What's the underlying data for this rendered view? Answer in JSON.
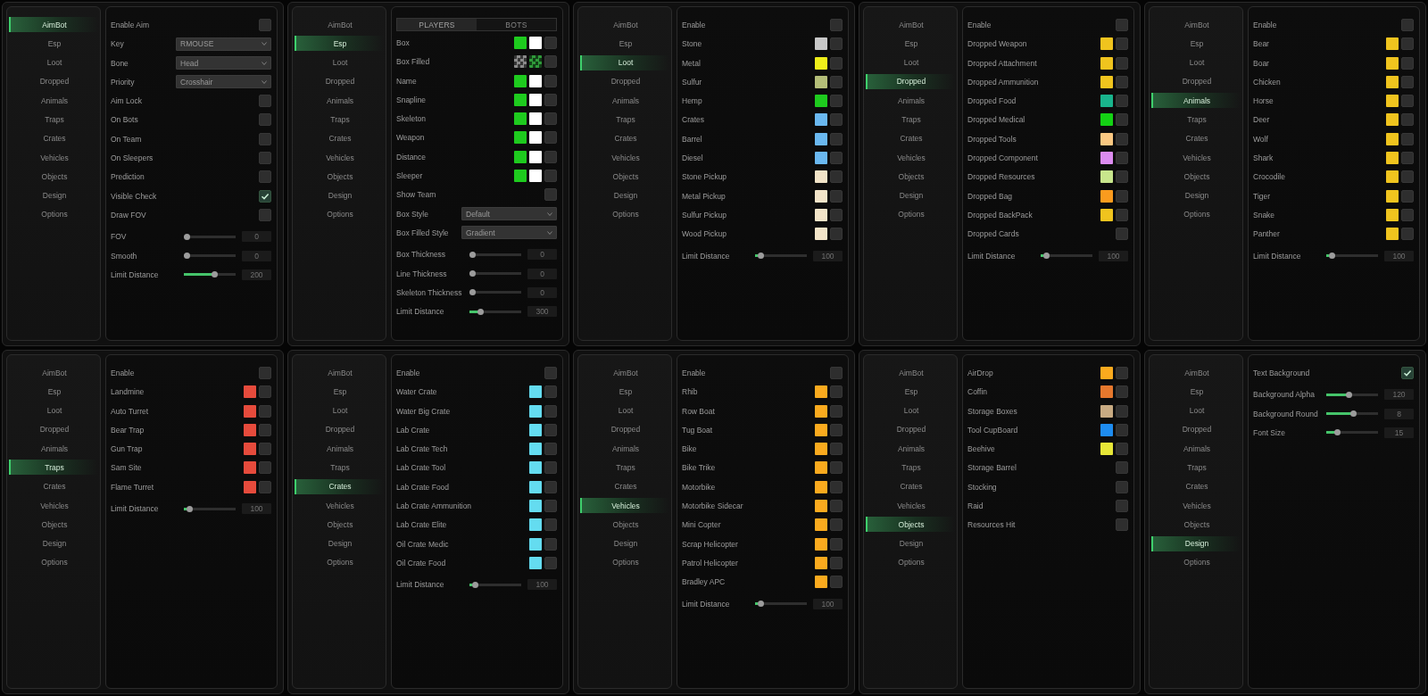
{
  "panels": [
    {
      "sidebar": [
        {
          "label": "AimBot",
          "selected": true
        },
        {
          "label": "Esp",
          "selected": false
        },
        {
          "label": "Loot",
          "selected": false
        },
        {
          "label": "Dropped",
          "selected": false
        },
        {
          "label": "Animals",
          "selected": false
        },
        {
          "label": "Traps",
          "selected": false
        },
        {
          "label": "Crates",
          "selected": false
        },
        {
          "label": "Vehicles",
          "selected": false
        },
        {
          "label": "Objects",
          "selected": false
        },
        {
          "label": "Design",
          "selected": false
        },
        {
          "label": "Options",
          "selected": false
        }
      ],
      "rows": [
        {
          "kind": "checkbox",
          "label": "Enable Aim",
          "checked": false
        },
        {
          "kind": "dropdown",
          "label": "Key",
          "value": "RMOUSE"
        },
        {
          "kind": "dropdown",
          "label": "Bone",
          "value": "Head"
        },
        {
          "kind": "dropdown",
          "label": "Priority",
          "value": "Crosshair"
        },
        {
          "kind": "checkbox",
          "label": "Aim Lock",
          "checked": false
        },
        {
          "kind": "checkbox",
          "label": "On Bots",
          "checked": false
        },
        {
          "kind": "checkbox",
          "label": "On Team",
          "checked": false
        },
        {
          "kind": "checkbox",
          "label": "On Sleepers",
          "checked": false
        },
        {
          "kind": "checkbox",
          "label": "Prediction",
          "checked": false
        },
        {
          "kind": "checkbox",
          "label": "Visible Check",
          "checked": true
        },
        {
          "kind": "checkbox",
          "label": "Draw FOV",
          "checked": false
        },
        {
          "kind": "slider",
          "label": "FOV",
          "level": 0,
          "reading": "0"
        },
        {
          "kind": "slider",
          "label": "Smooth",
          "level": 0,
          "reading": "0"
        },
        {
          "kind": "slider",
          "label": "Limit Distance",
          "level": 0.6,
          "reading": "200"
        }
      ]
    },
    {
      "sidebar": [
        {
          "label": "AimBot",
          "selected": false
        },
        {
          "label": "Esp",
          "selected": true
        },
        {
          "label": "Loot",
          "selected": false
        },
        {
          "label": "Dropped",
          "selected": false
        },
        {
          "label": "Animals",
          "selected": false
        },
        {
          "label": "Traps",
          "selected": false
        },
        {
          "label": "Crates",
          "selected": false
        },
        {
          "label": "Vehicles",
          "selected": false
        },
        {
          "label": "Objects",
          "selected": false
        },
        {
          "label": "Design",
          "selected": false
        },
        {
          "label": "Options",
          "selected": false
        }
      ],
      "tabs": [
        {
          "label": "PLAYERS",
          "selected": true
        },
        {
          "label": "BOTS",
          "selected": false
        }
      ],
      "rows": [
        {
          "kind": "color",
          "label": "Box",
          "swatches": [
            {
              "kind": "solid",
              "color": "#1ecb1e"
            },
            {
              "kind": "solid",
              "color": "#ffffff"
            }
          ],
          "checked": false
        },
        {
          "kind": "color",
          "label": "Box Filled",
          "swatches": [
            {
              "kind": "alpha",
              "color": "#8a8a8a"
            },
            {
              "kind": "alpha",
              "color": "#2f9a3a"
            }
          ],
          "checked": false
        },
        {
          "kind": "color",
          "label": "Name",
          "swatches": [
            {
              "kind": "solid",
              "color": "#1ecb1e"
            },
            {
              "kind": "solid",
              "color": "#ffffff"
            }
          ],
          "checked": false
        },
        {
          "kind": "color",
          "label": "Snapline",
          "swatches": [
            {
              "kind": "solid",
              "color": "#1ecb1e"
            },
            {
              "kind": "solid",
              "color": "#ffffff"
            }
          ],
          "checked": false
        },
        {
          "kind": "color",
          "label": "Skeleton",
          "swatches": [
            {
              "kind": "solid",
              "color": "#1ecb1e"
            },
            {
              "kind": "solid",
              "color": "#ffffff"
            }
          ],
          "checked": false
        },
        {
          "kind": "color",
          "label": "Weapon",
          "swatches": [
            {
              "kind": "solid",
              "color": "#1ecb1e"
            },
            {
              "kind": "solid",
              "color": "#ffffff"
            }
          ],
          "checked": false
        },
        {
          "kind": "color",
          "label": "Distance",
          "swatches": [
            {
              "kind": "solid",
              "color": "#1ecb1e"
            },
            {
              "kind": "solid",
              "color": "#ffffff"
            }
          ],
          "checked": false
        },
        {
          "kind": "color",
          "label": "Sleeper",
          "swatches": [
            {
              "kind": "solid",
              "color": "#1ecb1e"
            },
            {
              "kind": "solid",
              "color": "#ffffff"
            }
          ],
          "checked": false
        },
        {
          "kind": "checkbox",
          "label": "Show Team",
          "checked": false
        },
        {
          "kind": "dropdown",
          "label": "Box Style",
          "value": "Default"
        },
        {
          "kind": "dropdown",
          "label": "Box Filled Style",
          "value": "Gradient"
        },
        {
          "kind": "slider",
          "label": "Box Thickness",
          "level": 0,
          "reading": "0"
        },
        {
          "kind": "slider",
          "label": "Line Thickness",
          "level": 0,
          "reading": "0"
        },
        {
          "kind": "slider",
          "label": "Skeleton Thickness",
          "level": 0,
          "reading": "0"
        },
        {
          "kind": "slider",
          "label": "Limit Distance",
          "level": 0.17,
          "reading": "300"
        }
      ]
    },
    {
      "sidebar": [
        {
          "label": "AimBot",
          "selected": false
        },
        {
          "label": "Esp",
          "selected": false
        },
        {
          "label": "Loot",
          "selected": true
        },
        {
          "label": "Dropped",
          "selected": false
        },
        {
          "label": "Animals",
          "selected": false
        },
        {
          "label": "Traps",
          "selected": false
        },
        {
          "label": "Crates",
          "selected": false
        },
        {
          "label": "Vehicles",
          "selected": false
        },
        {
          "label": "Objects",
          "selected": false
        },
        {
          "label": "Design",
          "selected": false
        },
        {
          "label": "Options",
          "selected": false
        }
      ],
      "rows": [
        {
          "kind": "checkbox",
          "label": "Enable",
          "checked": false
        },
        {
          "kind": "color",
          "label": "Stone",
          "swatches": [
            {
              "kind": "solid",
              "color": "#c8c8c8"
            }
          ],
          "checked": false
        },
        {
          "kind": "color",
          "label": "Metal",
          "swatches": [
            {
              "kind": "solid",
              "color": "#eeee1a"
            }
          ],
          "checked": false
        },
        {
          "kind": "color",
          "label": "Sulfur",
          "swatches": [
            {
              "kind": "solid",
              "color": "#b4be78"
            }
          ],
          "checked": false
        },
        {
          "kind": "color",
          "label": "Hemp",
          "swatches": [
            {
              "kind": "solid",
              "color": "#1ecb1e"
            }
          ],
          "checked": false
        },
        {
          "kind": "color",
          "label": "Crates",
          "swatches": [
            {
              "kind": "solid",
              "color": "#6ab8f0"
            }
          ],
          "checked": false
        },
        {
          "kind": "color",
          "label": "Barrel",
          "swatches": [
            {
              "kind": "solid",
              "color": "#6ab8f0"
            }
          ],
          "checked": false
        },
        {
          "kind": "color",
          "label": "Diesel",
          "swatches": [
            {
              "kind": "solid",
              "color": "#6ab8f0"
            }
          ],
          "checked": false
        },
        {
          "kind": "color",
          "label": "Stone Pickup",
          "swatches": [
            {
              "kind": "solid",
              "color": "#f2e4c8"
            }
          ],
          "checked": false
        },
        {
          "kind": "color",
          "label": "Metal Pickup",
          "swatches": [
            {
              "kind": "solid",
              "color": "#f2e4c8"
            }
          ],
          "checked": false
        },
        {
          "kind": "color",
          "label": "Sulfur Pickup",
          "swatches": [
            {
              "kind": "solid",
              "color": "#f2e4c8"
            }
          ],
          "checked": false
        },
        {
          "kind": "color",
          "label": "Wood Pickup",
          "swatches": [
            {
              "kind": "solid",
              "color": "#f2e4c8"
            }
          ],
          "checked": false
        },
        {
          "kind": "slider",
          "label": "Limit Distance",
          "level": 0.05,
          "reading": "100"
        }
      ]
    },
    {
      "sidebar": [
        {
          "label": "AimBot",
          "selected": false
        },
        {
          "label": "Esp",
          "selected": false
        },
        {
          "label": "Loot",
          "selected": false
        },
        {
          "label": "Dropped",
          "selected": true
        },
        {
          "label": "Animals",
          "selected": false
        },
        {
          "label": "Traps",
          "selected": false
        },
        {
          "label": "Crates",
          "selected": false
        },
        {
          "label": "Vehicles",
          "selected": false
        },
        {
          "label": "Objects",
          "selected": false
        },
        {
          "label": "Design",
          "selected": false
        },
        {
          "label": "Options",
          "selected": false
        }
      ],
      "rows": [
        {
          "kind": "checkbox",
          "label": "Enable",
          "checked": false
        },
        {
          "kind": "color",
          "label": "Dropped Weapon",
          "swatches": [
            {
              "kind": "solid",
              "color": "#f0c41e"
            }
          ],
          "checked": false
        },
        {
          "kind": "color",
          "label": "Dropped Attachment",
          "swatches": [
            {
              "kind": "solid",
              "color": "#f0c41e"
            }
          ],
          "checked": false
        },
        {
          "kind": "color",
          "label": "Dropped Ammunition",
          "swatches": [
            {
              "kind": "solid",
              "color": "#f0c41e"
            }
          ],
          "checked": false
        },
        {
          "kind": "color",
          "label": "Dropped Food",
          "swatches": [
            {
              "kind": "solid",
              "color": "#19b48c"
            }
          ],
          "checked": false
        },
        {
          "kind": "color",
          "label": "Dropped Medical",
          "swatches": [
            {
              "kind": "solid",
              "color": "#14d214"
            }
          ],
          "checked": false
        },
        {
          "kind": "color",
          "label": "Dropped Tools",
          "swatches": [
            {
              "kind": "solid",
              "color": "#fac882"
            }
          ],
          "checked": false
        },
        {
          "kind": "color",
          "label": "Dropped Component",
          "swatches": [
            {
              "kind": "solid",
              "color": "#dc8cf0"
            }
          ],
          "checked": false
        },
        {
          "kind": "color",
          "label": "Dropped Resources",
          "swatches": [
            {
              "kind": "solid",
              "color": "#c8e68c"
            }
          ],
          "checked": false
        },
        {
          "kind": "color",
          "label": "Dropped Bag",
          "swatches": [
            {
              "kind": "solid",
              "color": "#fa9b1e"
            }
          ],
          "checked": false
        },
        {
          "kind": "color",
          "label": "Dropped BackPack",
          "swatches": [
            {
              "kind": "solid",
              "color": "#f0c41e"
            }
          ],
          "checked": false
        },
        {
          "kind": "checkbox",
          "label": "Dropped Cards",
          "checked": false
        },
        {
          "kind": "slider",
          "label": "Limit Distance",
          "level": 0.05,
          "reading": "100"
        }
      ]
    },
    {
      "sidebar": [
        {
          "label": "AimBot",
          "selected": false
        },
        {
          "label": "Esp",
          "selected": false
        },
        {
          "label": "Loot",
          "selected": false
        },
        {
          "label": "Dropped",
          "selected": false
        },
        {
          "label": "Animals",
          "selected": true
        },
        {
          "label": "Traps",
          "selected": false
        },
        {
          "label": "Crates",
          "selected": false
        },
        {
          "label": "Vehicles",
          "selected": false
        },
        {
          "label": "Objects",
          "selected": false
        },
        {
          "label": "Design",
          "selected": false
        },
        {
          "label": "Options",
          "selected": false
        }
      ],
      "rows": [
        {
          "kind": "checkbox",
          "label": "Enable",
          "checked": false
        },
        {
          "kind": "color",
          "label": "Bear",
          "swatches": [
            {
              "kind": "solid",
              "color": "#f0c41e"
            }
          ],
          "checked": false
        },
        {
          "kind": "color",
          "label": "Boar",
          "swatches": [
            {
              "kind": "solid",
              "color": "#f0c41e"
            }
          ],
          "checked": false
        },
        {
          "kind": "color",
          "label": "Chicken",
          "swatches": [
            {
              "kind": "solid",
              "color": "#f0c41e"
            }
          ],
          "checked": false
        },
        {
          "kind": "color",
          "label": "Horse",
          "swatches": [
            {
              "kind": "solid",
              "color": "#f0c41e"
            }
          ],
          "checked": false
        },
        {
          "kind": "color",
          "label": "Deer",
          "swatches": [
            {
              "kind": "solid",
              "color": "#f0c41e"
            }
          ],
          "checked": false
        },
        {
          "kind": "color",
          "label": "Wolf",
          "swatches": [
            {
              "kind": "solid",
              "color": "#f0c41e"
            }
          ],
          "checked": false
        },
        {
          "kind": "color",
          "label": "Shark",
          "swatches": [
            {
              "kind": "solid",
              "color": "#f0c41e"
            }
          ],
          "checked": false
        },
        {
          "kind": "color",
          "label": "Crocodile",
          "swatches": [
            {
              "kind": "solid",
              "color": "#f0c41e"
            }
          ],
          "checked": false
        },
        {
          "kind": "color",
          "label": "Tiger",
          "swatches": [
            {
              "kind": "solid",
              "color": "#f0c41e"
            }
          ],
          "checked": false
        },
        {
          "kind": "color",
          "label": "Snake",
          "swatches": [
            {
              "kind": "solid",
              "color": "#f0c41e"
            }
          ],
          "checked": false
        },
        {
          "kind": "color",
          "label": "Panther",
          "swatches": [
            {
              "kind": "solid",
              "color": "#f0c41e"
            }
          ],
          "checked": false
        },
        {
          "kind": "slider",
          "label": "Limit Distance",
          "level": 0.05,
          "reading": "100"
        }
      ]
    },
    {
      "sidebar": [
        {
          "label": "AimBot",
          "selected": false
        },
        {
          "label": "Esp",
          "selected": false
        },
        {
          "label": "Loot",
          "selected": false
        },
        {
          "label": "Dropped",
          "selected": false
        },
        {
          "label": "Animals",
          "selected": false
        },
        {
          "label": "Traps",
          "selected": true
        },
        {
          "label": "Crates",
          "selected": false
        },
        {
          "label": "Vehicles",
          "selected": false
        },
        {
          "label": "Objects",
          "selected": false
        },
        {
          "label": "Design",
          "selected": false
        },
        {
          "label": "Options",
          "selected": false
        }
      ],
      "rows": [
        {
          "kind": "checkbox",
          "label": "Enable",
          "checked": false
        },
        {
          "kind": "color",
          "label": "Landmine",
          "swatches": [
            {
              "kind": "solid",
              "color": "#e64b3c"
            }
          ],
          "checked": false
        },
        {
          "kind": "color",
          "label": "Auto Turret",
          "swatches": [
            {
              "kind": "solid",
              "color": "#e64b3c"
            }
          ],
          "checked": false
        },
        {
          "kind": "color",
          "label": "Bear Trap",
          "swatches": [
            {
              "kind": "solid",
              "color": "#e64b3c"
            }
          ],
          "checked": false
        },
        {
          "kind": "color",
          "label": "Gun Trap",
          "swatches": [
            {
              "kind": "solid",
              "color": "#e64b3c"
            }
          ],
          "checked": false
        },
        {
          "kind": "color",
          "label": "Sam Site",
          "swatches": [
            {
              "kind": "solid",
              "color": "#e64b3c"
            }
          ],
          "checked": false
        },
        {
          "kind": "color",
          "label": "Flame Turret",
          "swatches": [
            {
              "kind": "solid",
              "color": "#e64b3c"
            }
          ],
          "checked": false
        },
        {
          "kind": "slider",
          "label": "Limit Distance",
          "level": 0.05,
          "reading": "100"
        }
      ]
    },
    {
      "sidebar": [
        {
          "label": "AimBot",
          "selected": false
        },
        {
          "label": "Esp",
          "selected": false
        },
        {
          "label": "Loot",
          "selected": false
        },
        {
          "label": "Dropped",
          "selected": false
        },
        {
          "label": "Animals",
          "selected": false
        },
        {
          "label": "Traps",
          "selected": false
        },
        {
          "label": "Crates",
          "selected": true
        },
        {
          "label": "Vehicles",
          "selected": false
        },
        {
          "label": "Objects",
          "selected": false
        },
        {
          "label": "Design",
          "selected": false
        },
        {
          "label": "Options",
          "selected": false
        }
      ],
      "rows": [
        {
          "kind": "checkbox",
          "label": "Enable",
          "checked": false
        },
        {
          "kind": "color",
          "label": "Water Crate",
          "swatches": [
            {
              "kind": "solid",
              "color": "#64dcf0"
            }
          ],
          "checked": false
        },
        {
          "kind": "color",
          "label": "Water Big Crate",
          "swatches": [
            {
              "kind": "solid",
              "color": "#64dcf0"
            }
          ],
          "checked": false
        },
        {
          "kind": "color",
          "label": "Lab Crate",
          "swatches": [
            {
              "kind": "solid",
              "color": "#64dcf0"
            }
          ],
          "checked": false
        },
        {
          "kind": "color",
          "label": "Lab Crate Tech",
          "swatches": [
            {
              "kind": "solid",
              "color": "#64dcf0"
            }
          ],
          "checked": false
        },
        {
          "kind": "color",
          "label": "Lab Crate Tool",
          "swatches": [
            {
              "kind": "solid",
              "color": "#64dcf0"
            }
          ],
          "checked": false
        },
        {
          "kind": "color",
          "label": "Lab Crate Food",
          "swatches": [
            {
              "kind": "solid",
              "color": "#64dcf0"
            }
          ],
          "checked": false
        },
        {
          "kind": "color",
          "label": "Lab Crate Ammunition",
          "swatches": [
            {
              "kind": "solid",
              "color": "#64dcf0"
            }
          ],
          "checked": false
        },
        {
          "kind": "color",
          "label": "Lab Crate Elite",
          "swatches": [
            {
              "kind": "solid",
              "color": "#64dcf0"
            }
          ],
          "checked": false
        },
        {
          "kind": "color",
          "label": "Oil Crate Medic",
          "swatches": [
            {
              "kind": "solid",
              "color": "#64dcf0"
            }
          ],
          "checked": false
        },
        {
          "kind": "color",
          "label": "Oil Crate Food",
          "swatches": [
            {
              "kind": "solid",
              "color": "#64dcf0"
            }
          ],
          "checked": false
        },
        {
          "kind": "slider",
          "label": "Limit Distance",
          "level": 0.05,
          "reading": "100"
        }
      ]
    },
    {
      "sidebar": [
        {
          "label": "AimBot",
          "selected": false
        },
        {
          "label": "Esp",
          "selected": false
        },
        {
          "label": "Loot",
          "selected": false
        },
        {
          "label": "Dropped",
          "selected": false
        },
        {
          "label": "Animals",
          "selected": false
        },
        {
          "label": "Traps",
          "selected": false
        },
        {
          "label": "Crates",
          "selected": false
        },
        {
          "label": "Vehicles",
          "selected": true
        },
        {
          "label": "Objects",
          "selected": false
        },
        {
          "label": "Design",
          "selected": false
        },
        {
          "label": "Options",
          "selected": false
        }
      ],
      "rows": [
        {
          "kind": "checkbox",
          "label": "Enable",
          "checked": false
        },
        {
          "kind": "color",
          "label": "Rhib",
          "swatches": [
            {
              "kind": "solid",
              "color": "#faaa1e"
            }
          ],
          "checked": false
        },
        {
          "kind": "color",
          "label": "Row Boat",
          "swatches": [
            {
              "kind": "solid",
              "color": "#faaa1e"
            }
          ],
          "checked": false
        },
        {
          "kind": "color",
          "label": "Tug Boat",
          "swatches": [
            {
              "kind": "solid",
              "color": "#faaa1e"
            }
          ],
          "checked": false
        },
        {
          "kind": "color",
          "label": "Bike",
          "swatches": [
            {
              "kind": "solid",
              "color": "#faaa1e"
            }
          ],
          "checked": false
        },
        {
          "kind": "color",
          "label": "Bike Trike",
          "swatches": [
            {
              "kind": "solid",
              "color": "#faaa1e"
            }
          ],
          "checked": false
        },
        {
          "kind": "color",
          "label": "Motorbike",
          "swatches": [
            {
              "kind": "solid",
              "color": "#faaa1e"
            }
          ],
          "checked": false
        },
        {
          "kind": "color",
          "label": "Motorbike Sidecar",
          "swatches": [
            {
              "kind": "solid",
              "color": "#faaa1e"
            }
          ],
          "checked": false
        },
        {
          "kind": "color",
          "label": "Mini Copter",
          "swatches": [
            {
              "kind": "solid",
              "color": "#faaa1e"
            }
          ],
          "checked": false
        },
        {
          "kind": "color",
          "label": "Scrap Helicopter",
          "swatches": [
            {
              "kind": "solid",
              "color": "#faaa1e"
            }
          ],
          "checked": false
        },
        {
          "kind": "color",
          "label": "Patrol Helicopter",
          "swatches": [
            {
              "kind": "solid",
              "color": "#faaa1e"
            }
          ],
          "checked": false
        },
        {
          "kind": "color",
          "label": "Bradley APC",
          "swatches": [
            {
              "kind": "solid",
              "color": "#faaa1e"
            }
          ],
          "checked": false
        },
        {
          "kind": "slider",
          "label": "Limit Distance",
          "level": 0.05,
          "reading": "100"
        }
      ]
    },
    {
      "sidebar": [
        {
          "label": "AimBot",
          "selected": false
        },
        {
          "label": "Esp",
          "selected": false
        },
        {
          "label": "Loot",
          "selected": false
        },
        {
          "label": "Dropped",
          "selected": false
        },
        {
          "label": "Animals",
          "selected": false
        },
        {
          "label": "Traps",
          "selected": false
        },
        {
          "label": "Crates",
          "selected": false
        },
        {
          "label": "Vehicles",
          "selected": false
        },
        {
          "label": "Objects",
          "selected": true
        },
        {
          "label": "Design",
          "selected": false
        },
        {
          "label": "Options",
          "selected": false
        }
      ],
      "rows": [
        {
          "kind": "color",
          "label": "AirDrop",
          "swatches": [
            {
              "kind": "solid",
              "color": "#faaa1e"
            }
          ],
          "checked": false
        },
        {
          "kind": "color",
          "label": "Coffin",
          "swatches": [
            {
              "kind": "solid",
              "color": "#e6782d"
            }
          ],
          "checked": false
        },
        {
          "kind": "color",
          "label": "Storage Boxes",
          "swatches": [
            {
              "kind": "solid",
              "color": "#c8aa82"
            }
          ],
          "checked": false
        },
        {
          "kind": "color",
          "label": "Tool CupBoard",
          "swatches": [
            {
              "kind": "solid",
              "color": "#1e8cf0"
            }
          ],
          "checked": false
        },
        {
          "kind": "color",
          "label": "Beehive",
          "swatches": [
            {
              "kind": "solid",
              "color": "#e6e637"
            }
          ],
          "checked": false
        },
        {
          "kind": "checkbox",
          "label": "Storage Barrel",
          "checked": false
        },
        {
          "kind": "checkbox",
          "label": "Stocking",
          "checked": false
        },
        {
          "kind": "checkbox",
          "label": "Raid",
          "checked": false
        },
        {
          "kind": "checkbox",
          "label": "Resources Hit",
          "checked": false
        }
      ]
    },
    {
      "sidebar": [
        {
          "label": "AimBot",
          "selected": false
        },
        {
          "label": "Esp",
          "selected": false
        },
        {
          "label": "Loot",
          "selected": false
        },
        {
          "label": "Dropped",
          "selected": false
        },
        {
          "label": "Animals",
          "selected": false
        },
        {
          "label": "Traps",
          "selected": false
        },
        {
          "label": "Crates",
          "selected": false
        },
        {
          "label": "Vehicles",
          "selected": false
        },
        {
          "label": "Objects",
          "selected": false
        },
        {
          "label": "Design",
          "selected": true
        },
        {
          "label": "Options",
          "selected": false
        }
      ],
      "rows": [
        {
          "kind": "checkbox",
          "label": "Text Background",
          "checked": true
        },
        {
          "kind": "slider",
          "label": "Background Alpha",
          "level": 0.44,
          "reading": "120"
        },
        {
          "kind": "slider",
          "label": "Background Round",
          "level": 0.52,
          "reading": "8"
        },
        {
          "kind": "slider",
          "label": "Font Size",
          "level": 0.17,
          "reading": "15"
        }
      ]
    }
  ]
}
